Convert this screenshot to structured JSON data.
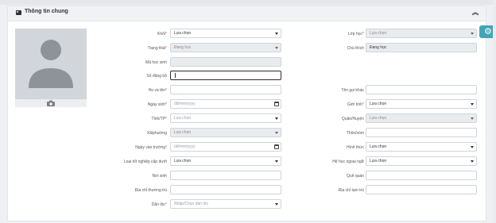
{
  "panel": {
    "title": "Thông tin chung"
  },
  "fields": {
    "khoi": {
      "label": "Khối",
      "value": "Lựa chọn"
    },
    "lop_hoc": {
      "label": "Lớp học",
      "value": "Lựa chọn"
    },
    "trang_thai": {
      "label": "Trạng thái",
      "value": "Đang học"
    },
    "chu_thich": {
      "label": "Chú thích",
      "value": "Đang học"
    },
    "ma_hoc_sinh": {
      "label": "Mã học sinh",
      "value": ""
    },
    "so_dang_bo": {
      "label": "Số đăng bộ",
      "value": ""
    },
    "ho_va_ten": {
      "label": "Họ và tên",
      "value": ""
    },
    "ten_goi_khac": {
      "label": "Tên gọi khác",
      "value": ""
    },
    "ngay_sinh": {
      "label": "Ngày sinh",
      "placeholder": "dd/mm/yyyy"
    },
    "gioi_tinh": {
      "label": "Giới tính",
      "value": "Lựa chọn"
    },
    "tinh_tp": {
      "label": "Tỉnh/TP",
      "value": "Lựa chọn"
    },
    "quan_huyen": {
      "label": "Quận/Huyện",
      "value": "Lựa chọn"
    },
    "xa_phuong": {
      "label": "Xã/phường",
      "value": "Lựa chọn"
    },
    "thon_xom": {
      "label": "Thôn/xóm",
      "value": ""
    },
    "ngay_vao_truong": {
      "label": "Ngày vào trường",
      "placeholder": "dd/mm/yyyy"
    },
    "hinh_thuc": {
      "label": "Hình thức",
      "value": "Lựa chọn"
    },
    "loai_tot_nghiep": {
      "label": "Loại tốt nghiệp cấp dưới",
      "value": "Lựa chọn"
    },
    "he_hoc_ngoai_ngu": {
      "label": "Hệ học ngoại ngữ",
      "value": "Lựa chọn"
    },
    "noi_sinh": {
      "label": "Nơi sinh",
      "value": ""
    },
    "que_quan": {
      "label": "Quê quán",
      "value": ""
    },
    "dia_chi_thuong_tru": {
      "label": "Địa chỉ thường trú",
      "value": ""
    },
    "dia_chi_tam_tru": {
      "label": "Địa chỉ tạm trú",
      "value": ""
    },
    "dan_toc": {
      "label": "Dân tộc",
      "placeholder": "Nhập/Chọn dân tộc"
    }
  },
  "required_mark": "*",
  "icons": {
    "header": "id-card-icon",
    "collapse": "double-chevron-up-icon",
    "settings": "gear-icon",
    "avatar": "user-silhouette",
    "upload": "camera-icon",
    "dropdown": "caret-down-icon",
    "date": "calendar-icon"
  },
  "colors": {
    "accent": "#42a5b7",
    "required": "#e04848",
    "disabled_bg": "#e9ecef",
    "border": "#ced4da"
  }
}
